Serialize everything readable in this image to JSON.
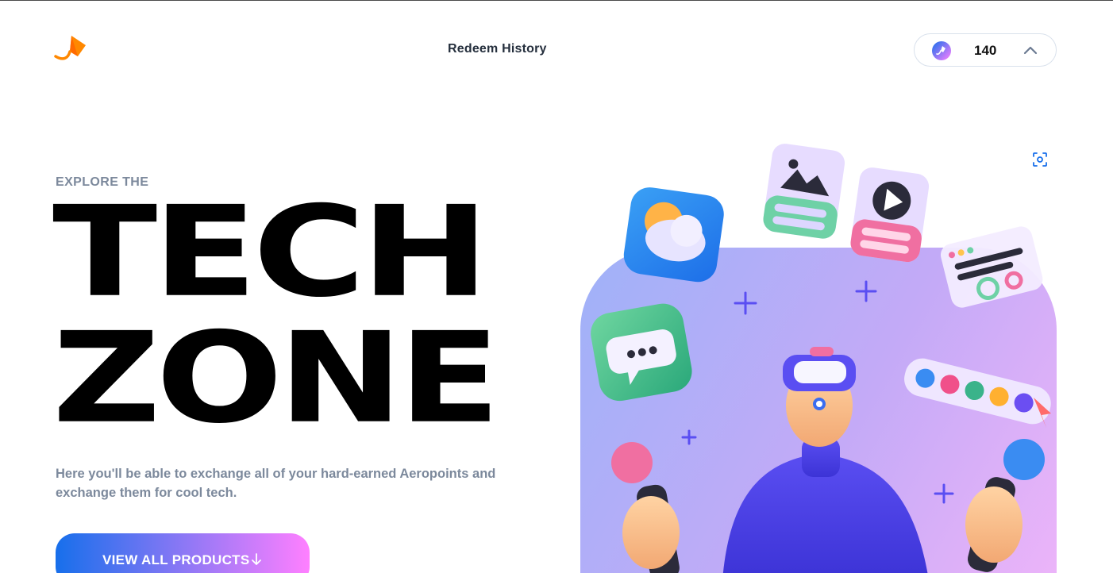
{
  "header": {
    "nav_link": "Redeem History",
    "points": "140"
  },
  "hero": {
    "eyebrow": "EXPLORE THE",
    "headline_line1": "TECH",
    "headline_line2": "ZONE",
    "description": "Here you'll be able to exchange all of your hard-earned Aeropoints and exchange them for cool tech.",
    "cta_label": "VIEW ALL PRODUCTS"
  },
  "icons": {
    "logo": "kite-logo-icon",
    "coin": "aeropoints-coin-icon",
    "chevron": "chevron-up-icon",
    "cta_arrow": "arrow-down-icon",
    "scan": "scan-icon",
    "illustration": "vr-person-illustration"
  },
  "colors": {
    "brand_orange": "#ff8800",
    "text_dark": "#252f3d",
    "text_muted": "#7c899c",
    "cta_gradient_start": "#176feb",
    "cta_gradient_end": "#ff80ff",
    "accent_blue": "#176feb"
  }
}
